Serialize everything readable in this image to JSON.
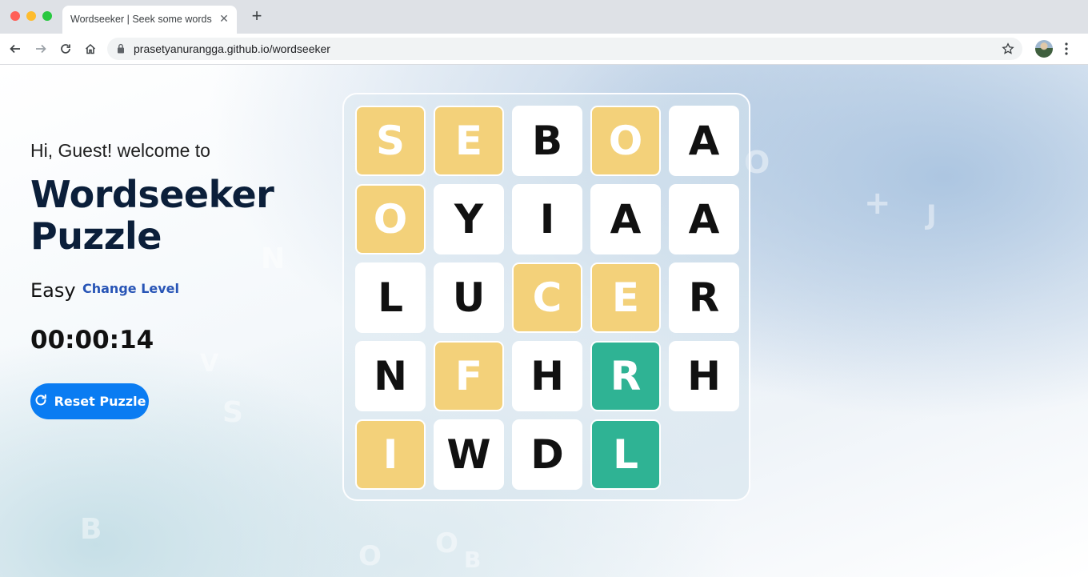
{
  "browser": {
    "tab_title": "Wordseeker | Seek some words",
    "url": "prasetyanurangga.github.io/wordseeker",
    "icons": {
      "close": "close-icon",
      "new_tab": "plus-icon",
      "back": "arrow-left-icon",
      "forward": "arrow-right-icon",
      "reload": "reload-icon",
      "home": "home-icon",
      "lock": "lock-icon",
      "bookmark": "star-icon",
      "menu": "more-vert-icon"
    }
  },
  "sidebar": {
    "greeting": "Hi, Guest! welcome to",
    "title": "Wordseeker Puzzle",
    "level": "Easy",
    "change_level_label": "Change Level",
    "timer": "00:00:14",
    "reset_label": "Reset Puzzle",
    "reset_icon": "refresh-icon"
  },
  "board": {
    "colors": {
      "selected": "#f3d17a",
      "found": "#2fb394",
      "default": "#ffffff"
    },
    "rows": [
      [
        {
          "letter": "S",
          "state": "selected"
        },
        {
          "letter": "E",
          "state": "selected"
        },
        {
          "letter": "B",
          "state": "default"
        },
        {
          "letter": "O",
          "state": "selected"
        },
        {
          "letter": "A",
          "state": "default"
        }
      ],
      [
        {
          "letter": "O",
          "state": "selected"
        },
        {
          "letter": "Y",
          "state": "default"
        },
        {
          "letter": "I",
          "state": "default"
        },
        {
          "letter": "A",
          "state": "default"
        },
        {
          "letter": "A",
          "state": "default"
        }
      ],
      [
        {
          "letter": "L",
          "state": "default"
        },
        {
          "letter": "U",
          "state": "default"
        },
        {
          "letter": "C",
          "state": "selected"
        },
        {
          "letter": "E",
          "state": "selected"
        },
        {
          "letter": "R",
          "state": "default"
        }
      ],
      [
        {
          "letter": "N",
          "state": "default"
        },
        {
          "letter": "F",
          "state": "selected"
        },
        {
          "letter": "H",
          "state": "default"
        },
        {
          "letter": "R",
          "state": "found"
        },
        {
          "letter": "H",
          "state": "default"
        }
      ],
      [
        {
          "letter": "I",
          "state": "selected"
        },
        {
          "letter": "W",
          "state": "default"
        },
        {
          "letter": "D",
          "state": "default"
        },
        {
          "letter": "L",
          "state": "found"
        },
        {
          "letter": "",
          "state": "empty"
        }
      ]
    ]
  }
}
